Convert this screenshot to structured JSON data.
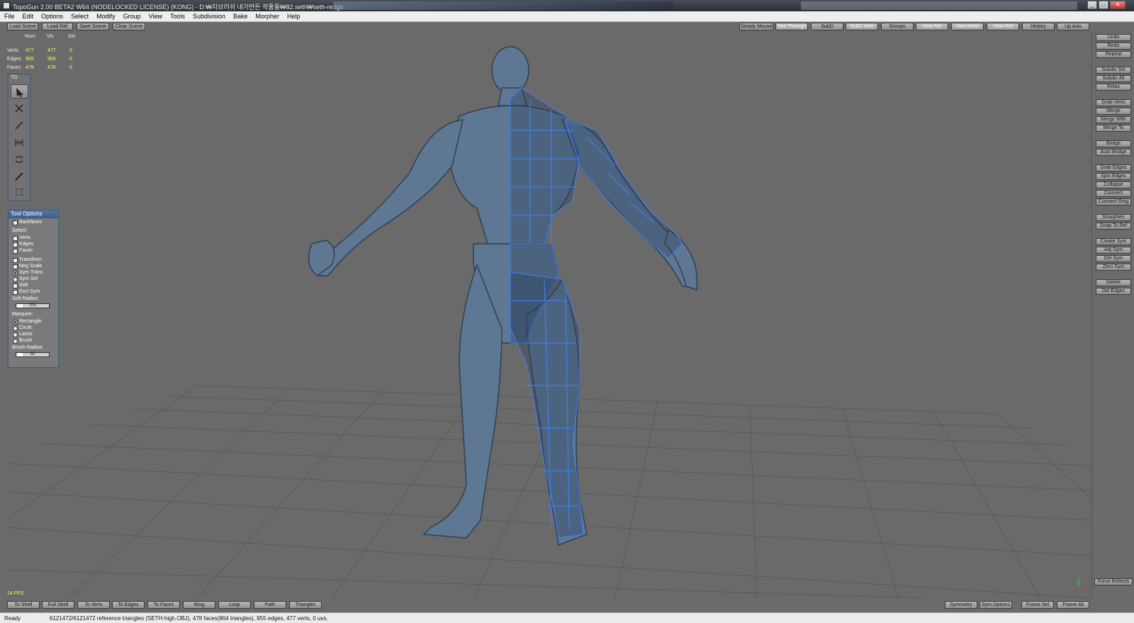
{
  "window": {
    "title": "TopoGun 2.00 BETA2 W64  (NODELOCKED LICENSE) (KONG) - D:₩지브러쉬 내가만든 작품들₩82.seth₩seth-re.tgs",
    "minimize": "_",
    "maximize": "□",
    "close": "✕"
  },
  "menu": [
    "File",
    "Edit",
    "Options",
    "Select",
    "Modify",
    "Group",
    "View",
    "Tools",
    "Subdivision",
    "Bake",
    "Morpher",
    "Help"
  ],
  "top_toolbar": {
    "left": [
      "Load Scene",
      "Load Ref",
      "Save Scene",
      "Clear Scene"
    ],
    "right": [
      "Steady Mouse",
      "See Through",
      "SubD",
      "SubD Wire",
      "Groups",
      "View Net",
      "View Mesh",
      "View Ref",
      "History",
      "Up Axis"
    ]
  },
  "stats": {
    "headers": [
      "Num",
      "Vis",
      "Sel"
    ],
    "rows": [
      {
        "label": "Verts",
        "num": "477",
        "vis": "477",
        "sel": "0"
      },
      {
        "label": "Edges",
        "num": "955",
        "vis": "955",
        "sel": "0"
      },
      {
        "label": "Faces",
        "num": "478",
        "vis": "478",
        "sel": "0"
      }
    ]
  },
  "tg_panel": {
    "title": "TG",
    "tools": [
      "select-tool-icon",
      "delete-tool-icon",
      "create-tool-icon",
      "bridge-tool-icon",
      "tweak-tool-icon",
      "brush-tool-icon",
      "draw-tool-icon"
    ]
  },
  "tool_options": {
    "title": "Tool Options",
    "backfaces": "Backfaces",
    "select_label": "Select:",
    "verts": "Verts",
    "edges": "Edges",
    "faces": "Faces",
    "transform": "Transform",
    "neg_scale": "Neg Scale",
    "sym_trans": "Sym Trans",
    "sym_sel": "Sym Sel",
    "soft": "Soft",
    "excl_sym": "Excl Sym",
    "soft_radius_label": "Soft Radius:",
    "soft_radius_value": "200",
    "marquee_label": "Marquee:",
    "rectangle": "Rectangle",
    "circle": "Circle",
    "lasso": "Lasso",
    "brush": "Brush",
    "brush_radius_label": "Brush Radius:",
    "brush_radius_value": "50"
  },
  "right_panel": {
    "groups": [
      [
        "Undo",
        "Redo",
        "Repeat"
      ],
      [
        "Subdiv Sel",
        "Subdiv All",
        "Relax"
      ],
      [
        "Grab Verts",
        "Merge",
        "Merge With",
        "Merge To"
      ],
      [
        "Bridge",
        "Auto Bridge"
      ],
      [
        "Grab Edges",
        "Spin Edges",
        "Collapse",
        "Connect",
        "Connect Ring"
      ],
      [
        "Straighten",
        "Snap To Ref"
      ],
      [
        "Create Sym",
        "Adj Sym",
        "Del Sym",
        "Zero Sym"
      ],
      [
        "Delete",
        "Del Edges"
      ]
    ],
    "force_refresh": "Force Refresh"
  },
  "bottom_toolbar": {
    "left": [
      "To Shell",
      "Full Shell",
      "To Verts",
      "To Edges",
      "To Faces",
      "Ring",
      "Loop",
      "Path",
      "Triangles"
    ],
    "right": [
      "Symmetry",
      "Sym Options",
      "Frame Sel",
      "Frame All"
    ]
  },
  "fps": "14 FPS",
  "status": {
    "ready": "Ready",
    "message": "6121472/6121472 reference triangles (SETH-high.OBJ), 478 faces(864 triangles), 955 edges, 477 verts, 0 uvs."
  },
  "colors": {
    "viewport_bg": "#6a6a6a",
    "model": "#5e7894",
    "mesh_wire": "#3f82ff",
    "stat_value": "#ffff44",
    "panel_title": "#4a6b99"
  }
}
